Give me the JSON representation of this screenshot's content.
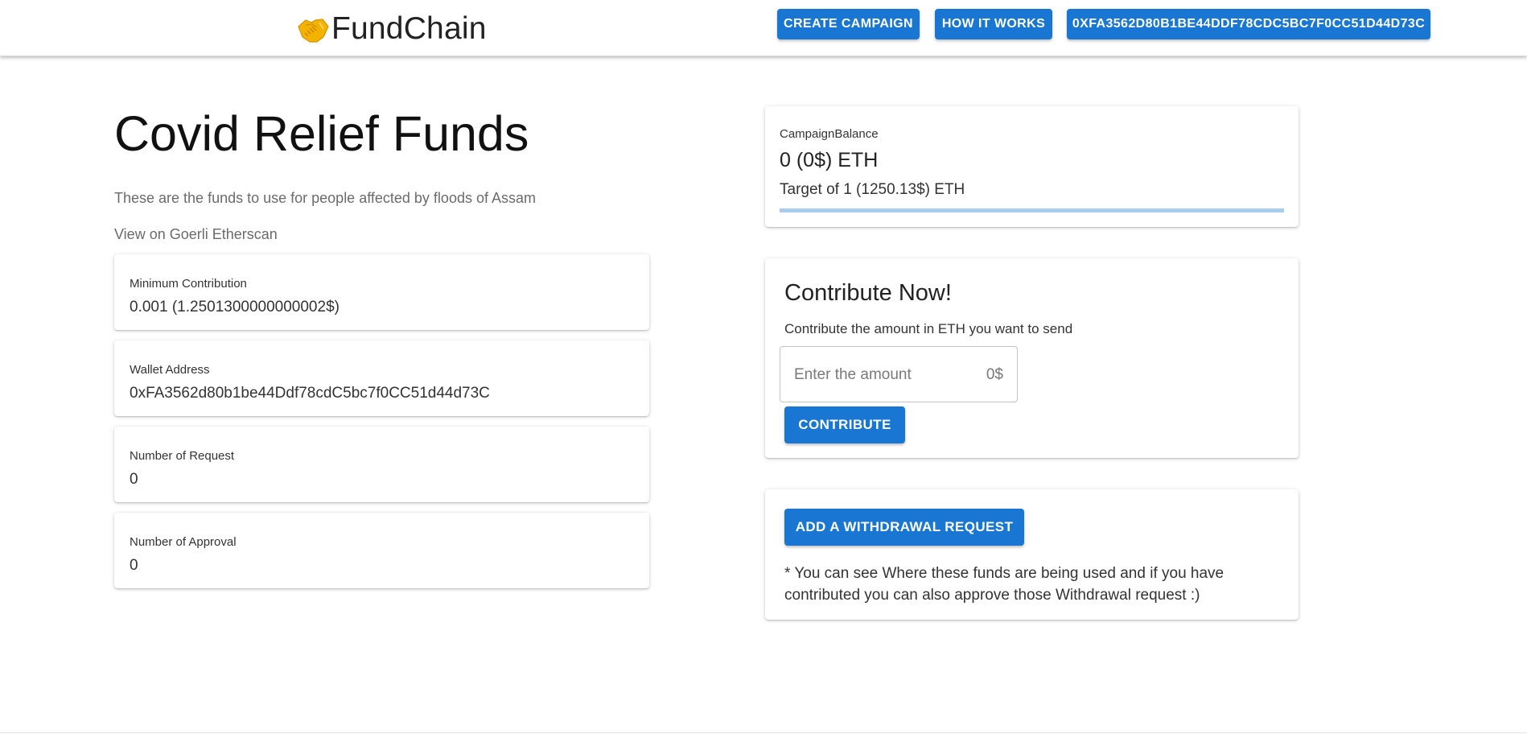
{
  "header": {
    "brand_name": "FundChain",
    "brand_icon": "handshake-icon",
    "nav": {
      "create_campaign": "CREATE CAMPAIGN",
      "how_it_works": "HOW IT WORKS",
      "wallet_address": "0XFA3562D80B1BE44DDF78CDC5BC7F0CC51D44D73C"
    }
  },
  "campaign": {
    "title": "Covid Relief Funds",
    "description": "These are the funds to use for people affected by floods of Assam",
    "etherscan_link": "View on Goerli Etherscan",
    "details": [
      {
        "label": "Minimum Contribution",
        "value": "0.001 (1.2501300000000002$)"
      },
      {
        "label": "Wallet Address",
        "value": "0xFA3562d80b1be44Ddf78cdC5bc7f0CC51d44d73C"
      },
      {
        "label": "Number of Request",
        "value": "0"
      },
      {
        "label": "Number of Approval",
        "value": "0"
      }
    ]
  },
  "balance": {
    "label": "CampaignBalance",
    "value": "0 (0$) ETH",
    "target": "Target of 1 (1250.13$) ETH",
    "progress_fraction": 0
  },
  "contribute": {
    "title": "Contribute Now!",
    "subtitle": "Contribute the amount in ETH you want to send",
    "amount_placeholder": "Enter the amount",
    "amount_value": "",
    "amount_usd": "0$",
    "button": "CONTRIBUTE"
  },
  "withdraw": {
    "button": "ADD A WITHDRAWAL REQUEST",
    "note": "* You can see Where these funds are being used and if you have contributed you can also approve those Withdrawal request :)"
  },
  "colors": {
    "primary": "#1976d2",
    "progress_track": "#a9cdf1",
    "handshake": "#f5b301"
  }
}
